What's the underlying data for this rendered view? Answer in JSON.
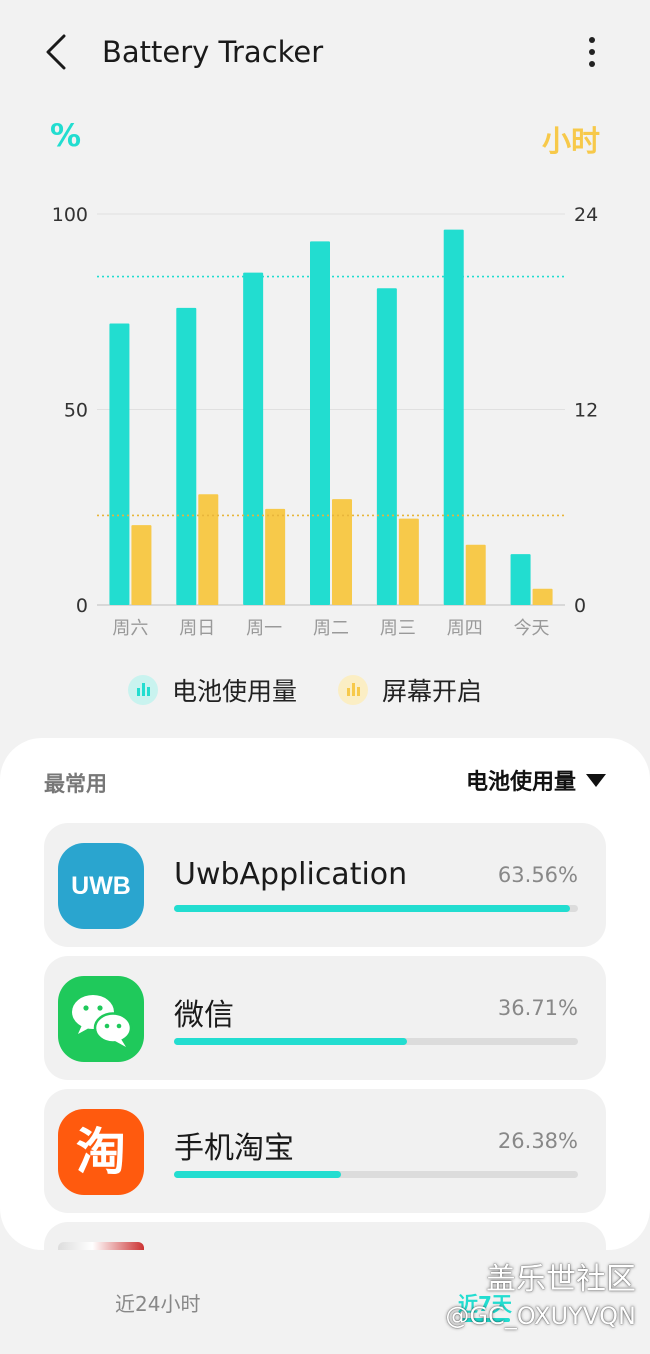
{
  "colors": {
    "battery": "#22ddd0",
    "screen": "#f7c94a",
    "card_bg": "#ffffff",
    "page_bg": "#f2f2f2"
  },
  "header": {
    "title": "Battery Tracker",
    "back_icon": "chevron-left-icon",
    "menu_icon": "more-vertical-icon"
  },
  "axis_units": {
    "left": "%",
    "right": "小时"
  },
  "chart_data": {
    "type": "bar",
    "categories": [
      "周六",
      "周日",
      "周一",
      "周二",
      "周三",
      "周四",
      "今天"
    ],
    "series": [
      {
        "name": "电池使用量",
        "axis": "left",
        "values": [
          72,
          76,
          85,
          93,
          81,
          96,
          13
        ]
      },
      {
        "name": "屏幕开启",
        "axis": "right",
        "values": [
          4.9,
          6.8,
          5.9,
          6.5,
          5.3,
          3.7,
          1.0
        ]
      }
    ],
    "left_axis": {
      "ylim": [
        0,
        100
      ],
      "ticks": [
        "0",
        "50",
        "100"
      ]
    },
    "right_axis": {
      "ylim": [
        0,
        24
      ],
      "ticks": [
        "0",
        "12",
        "24"
      ]
    },
    "averages": {
      "battery": 84,
      "screen": 5.5
    },
    "grid": true,
    "legend_position": "bottom"
  },
  "legend": [
    {
      "label": "电池使用量",
      "icon": "bar-chart-icon"
    },
    {
      "label": "屏幕开启",
      "icon": "bar-chart-icon"
    }
  ],
  "apps_section": {
    "label": "最常用",
    "sort_label": "电池使用量",
    "apps": [
      {
        "name": "UwbApplication",
        "percent": "63.56%",
        "share": 0.98,
        "icon": "uwb-app-icon",
        "icon_text": "UWB"
      },
      {
        "name": "微信",
        "percent": "36.71%",
        "share": 0.577,
        "icon": "wechat-icon"
      },
      {
        "name": "手机淘宝",
        "percent": "26.38%",
        "share": 0.413,
        "icon": "taobao-icon",
        "icon_text": "淘"
      }
    ]
  },
  "tabs": [
    {
      "label": "近24小时",
      "active": false
    },
    {
      "label": "近7天",
      "active": true
    }
  ],
  "watermark": {
    "line1": "盖乐世社区",
    "line2": "@GC_OXUYVQN"
  }
}
